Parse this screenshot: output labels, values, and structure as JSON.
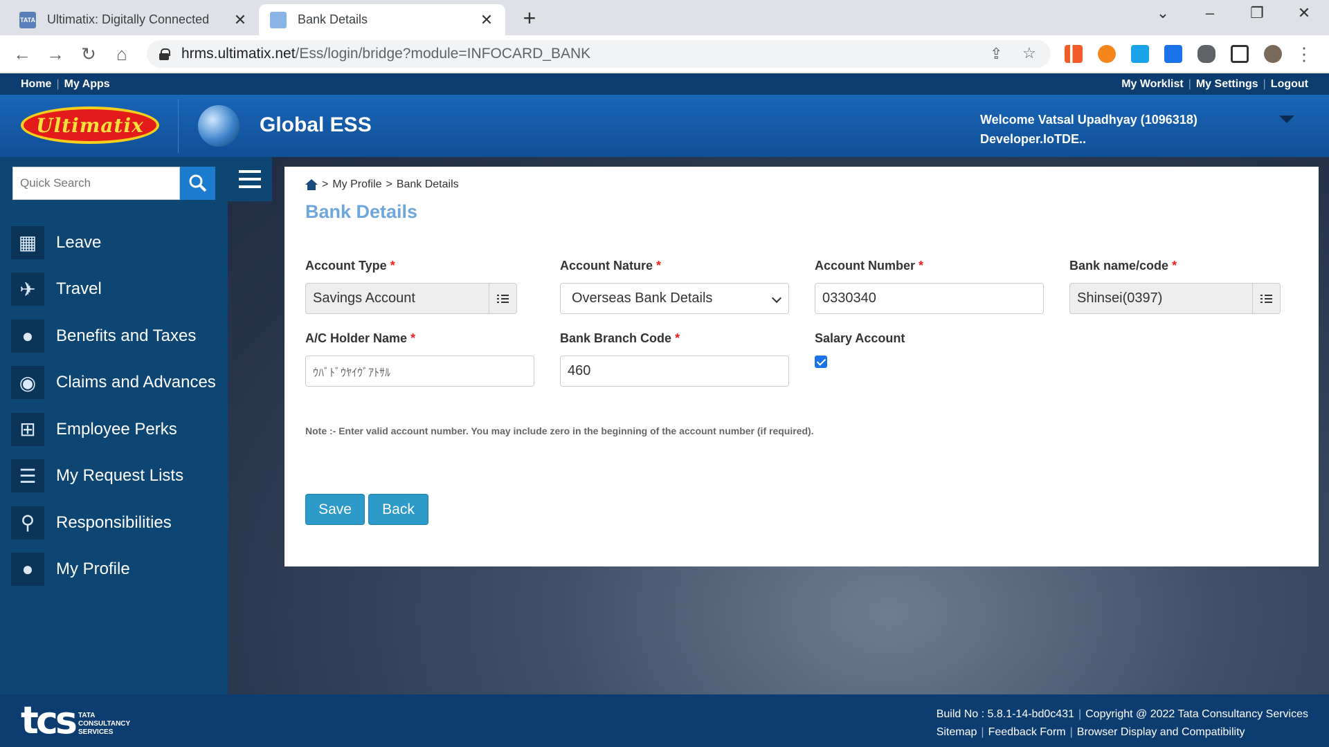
{
  "browser": {
    "tabs": [
      {
        "title": "Ultimatix: Digitally Connected",
        "active": false
      },
      {
        "title": "Bank Details",
        "active": true
      }
    ],
    "url_host": "hrms.ultimatix.net",
    "url_path": "/Ess/login/bridge?module=INFOCARD_BANK"
  },
  "toplinks": {
    "home": "Home",
    "my_apps": "My Apps",
    "my_worklist": "My Worklist",
    "my_settings": "My Settings",
    "logout": "Logout"
  },
  "header": {
    "logo_text": "Ultimatix",
    "app_name": "Global ESS",
    "welcome_line1": "Welcome Vatsal Upadhyay (1096318)",
    "welcome_line2": "Developer.IoTDE.."
  },
  "sidebar": {
    "search_placeholder": "Quick Search",
    "items": [
      {
        "label": "Leave",
        "icon": "calendar-icon"
      },
      {
        "label": "Travel",
        "icon": "airplane-icon"
      },
      {
        "label": "Benefits and Taxes",
        "icon": "piggy-bank-icon"
      },
      {
        "label": "Claims and Advances",
        "icon": "money-bag-icon"
      },
      {
        "label": "Employee Perks",
        "icon": "gift-icon"
      },
      {
        "label": "My Request Lists",
        "icon": "list-icon"
      },
      {
        "label": "Responsibilities",
        "icon": "org-chart-icon"
      },
      {
        "label": "My Profile",
        "icon": "user-icon"
      }
    ]
  },
  "breadcrumb": {
    "sep": ">",
    "item1": "My Profile",
    "item2": "Bank Details"
  },
  "form": {
    "title": "Bank Details",
    "account_type": {
      "label": "Account Type",
      "value": "Savings Account"
    },
    "account_nature": {
      "label": "Account Nature",
      "value": "Overseas Bank Details"
    },
    "account_number": {
      "label": "Account Number",
      "value": "0330340"
    },
    "bank_name_code": {
      "label": "Bank name/code",
      "value": "Shinsei(0397)"
    },
    "holder_name": {
      "label": "A/C Holder Name",
      "value": "ｳﾊﾞﾄﾞｳﾔｲｳﾞｱﾄｻﾙ"
    },
    "branch_code": {
      "label": "Bank Branch Code",
      "value": "460"
    },
    "salary_account": {
      "label": "Salary Account",
      "checked": true
    },
    "required_mark": "*",
    "note": "Note :- Enter valid account number. You may include zero in the beginning of the account number (if required).",
    "save_label": "Save",
    "back_label": "Back"
  },
  "footer": {
    "logo_text": "tcs",
    "logo_sub": "TATA CONSULTANCY SERVICES",
    "build": "Build No : 5.8.1-14-bd0c431",
    "copyright": "Copyright @ 2022 Tata Consultancy Services",
    "sitemap": "Sitemap",
    "feedback": "Feedback Form",
    "browser_compat": "Browser Display and Compatibility"
  },
  "colors": {
    "header_blue": "#1a66b8",
    "sidebar_blue": "#0d4573",
    "title_blue": "#6ea7dc",
    "button_blue": "#2d9bc9",
    "required_red": "#e22222"
  }
}
